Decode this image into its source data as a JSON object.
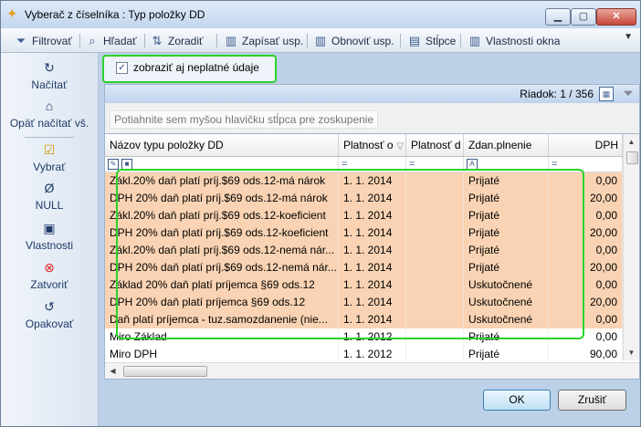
{
  "window": {
    "title": "Vyberač z číselníka : Typ položky DD"
  },
  "toolbar": {
    "items": [
      {
        "label": "Filtrovať",
        "icon": "filter-icon"
      },
      {
        "label": "Hľadať",
        "icon": "search-icon"
      },
      {
        "label": "Zoradiť",
        "icon": "sort-icon"
      },
      {
        "label": "Zapísať usp.",
        "icon": "save-layout-icon"
      },
      {
        "label": "Obnoviť usp.",
        "icon": "restore-layout-icon"
      },
      {
        "label": "Stĺpce",
        "icon": "columns-icon"
      },
      {
        "label": "Vlastnosti okna",
        "icon": "window-properties-icon"
      }
    ]
  },
  "sidebar": {
    "items": [
      {
        "label": "Načítať",
        "icon": "reload-icon"
      },
      {
        "label": "Opäť načítať vš.",
        "icon": "reload-all-icon"
      },
      {
        "label": "Vybrať",
        "icon": "select-icon"
      },
      {
        "label": "NULL",
        "icon": "null-icon"
      },
      {
        "label": "Vlastnosti",
        "icon": "properties-icon"
      },
      {
        "label": "Zatvoriť",
        "icon": "close-icon"
      },
      {
        "label": "Opakovať",
        "icon": "repeat-icon"
      }
    ]
  },
  "options": {
    "show_invalid_label": "zobraziť aj neplatné údaje",
    "show_invalid_checked": true
  },
  "grid": {
    "row_info": "Riadok: 1 / 356",
    "group_hint": "Potiahnite sem myšou hlavičku stĺpca pre zoskupenie",
    "columns": [
      "Názov typu položky DD",
      "Platnosť o",
      "Platnosť d",
      "Zdan.plnenie",
      "DPH"
    ],
    "rows": [
      {
        "name": "Zákl.20% daň platí príj.$69 ods.12-má nárok",
        "from": "1. 1. 2014",
        "to": "",
        "taxable": "Prijaté",
        "dph": "0,00",
        "highlight": true
      },
      {
        "name": "DPH 20% daň platí príj.$69 ods.12-má nárok",
        "from": "1. 1. 2014",
        "to": "",
        "taxable": "Prijaté",
        "dph": "20,00",
        "highlight": true
      },
      {
        "name": "Zákl.20% daň platí príj.$69 ods.12-koeficient",
        "from": "1. 1. 2014",
        "to": "",
        "taxable": "Prijaté",
        "dph": "0,00",
        "highlight": true
      },
      {
        "name": "DPH 20% daň platí príj.$69 ods.12-koeficient",
        "from": "1. 1. 2014",
        "to": "",
        "taxable": "Prijaté",
        "dph": "20,00",
        "highlight": true
      },
      {
        "name": "Zákl.20% daň platí príj.$69 ods.12-nemá nár...",
        "from": "1. 1. 2014",
        "to": "",
        "taxable": "Prijaté",
        "dph": "0,00",
        "highlight": true
      },
      {
        "name": "DPH 20% daň platí príj.$69 ods.12-nemá nár...",
        "from": "1. 1. 2014",
        "to": "",
        "taxable": "Prijaté",
        "dph": "20,00",
        "highlight": true
      },
      {
        "name": "Základ 20% daň platí príjemca §69 ods.12",
        "from": "1. 1. 2014",
        "to": "",
        "taxable": "Uskutočnené",
        "dph": "0,00",
        "highlight": true
      },
      {
        "name": "DPH 20% daň platí príjemca §69 ods.12",
        "from": "1. 1. 2014",
        "to": "",
        "taxable": "Uskutočnené",
        "dph": "20,00",
        "highlight": true
      },
      {
        "name": "Daň platí príjemca - tuz.samozdanenie (nie...",
        "from": "1. 1. 2014",
        "to": "",
        "taxable": "Uskutočnené",
        "dph": "0,00",
        "highlight": true
      },
      {
        "name": "Miro Základ",
        "from": "1. 1. 2012",
        "to": "",
        "taxable": "Prijaté",
        "dph": "0,00",
        "highlight": false
      },
      {
        "name": "Miro DPH",
        "from": "1. 1. 2012",
        "to": "",
        "taxable": "Prijaté",
        "dph": "90,00",
        "highlight": false
      }
    ]
  },
  "buttons": {
    "ok": "OK",
    "cancel": "Zrušiť"
  },
  "colors": {
    "highlight_row": "#f9d3b3",
    "annotation_box": "#2ad32a"
  }
}
